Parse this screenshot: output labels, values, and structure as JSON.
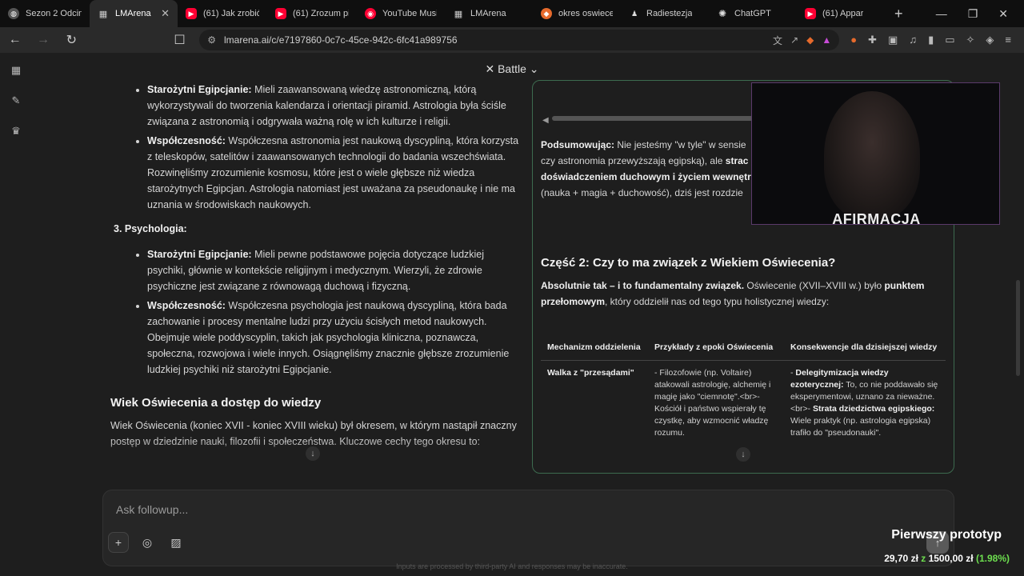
{
  "tabs": [
    {
      "label": "Sezon 2 Odcine",
      "icon": "globe-icon",
      "color": "#888888"
    },
    {
      "label": "LMArena",
      "icon": "table-icon",
      "color": "#bbbbbb",
      "active": true
    },
    {
      "label": "(61) Jak zrobić s",
      "icon": "youtube-icon",
      "color": "#ff0033"
    },
    {
      "label": "(61) Zrozum pi",
      "icon": "youtube-icon",
      "color": "#ff0033"
    },
    {
      "label": "YouTube Music",
      "icon": "youtube-music-icon",
      "color": "#ff0033"
    },
    {
      "label": "LMArena",
      "icon": "table-icon",
      "color": "#bbbbbb"
    },
    {
      "label": "okres oswiecen",
      "icon": "brave-icon",
      "color": "#e66a2c"
    },
    {
      "label": "Radiestezja",
      "icon": "pendulum-icon",
      "color": "#dddddd"
    },
    {
      "label": "ChatGPT",
      "icon": "openai-icon",
      "color": "#dddddd"
    },
    {
      "label": "(61) Appar",
      "icon": "youtube-icon",
      "color": "#ff0033"
    }
  ],
  "url": "lmarena.ai/c/e7197860-0c7c-45ce-942c-6fc41a989756",
  "header": {
    "mode": "Battle"
  },
  "left": {
    "egypt_astro_label": "Starożytni Egipcjanie:",
    "egypt_astro_text": " Mieli zaawansowaną wiedzę astronomiczną, którą wykorzystywali do tworzenia kalendarza i orientacji piramid. Astrologia była ściśle związana z astronomią i odgrywała ważną rolę w ich kulturze i religii.",
    "modern_astro_label": "Współczesność:",
    "modern_astro_text": " Współczesna astronomia jest naukową dyscypliną, która korzysta z teleskopów, satelitów i zaawansowanych technologii do badania wszechświata. Rozwinęliśmy zrozumienie kosmosu, które jest o wiele głębsze niż wiedza starożytnych Egipcjan. Astrologia natomiast jest uważana za pseudonaukę i nie ma uznania w środowiskach naukowych.",
    "section3": "3.  Psychologia:",
    "egypt_psy_label": "Starożytni Egipcjanie:",
    "egypt_psy_text": " Mieli pewne podstawowe pojęcia dotyczące ludzkiej psychiki, głównie w kontekście religijnym i medycznym. Wierzyli, że zdrowie psychiczne jest związane z równowagą duchową i fizyczną.",
    "modern_psy_label": "Współczesność:",
    "modern_psy_text": " Współczesna psychologia jest naukową dyscypliną, która bada zachowanie i procesy mentalne ludzi przy użyciu ścisłych metod naukowych. Obejmuje wiele poddyscyplin, takich jak psychologia kliniczna, poznawcza, społeczna, rozwojowa i wiele innych. Osiągnęliśmy znacznie głębsze zrozumienie ludzkiej psychiki niż starożytni Egipcjanie.",
    "heading": "Wiek Oświecenia a dostęp do wiedzy",
    "paragraph": "Wiek Oświecenia (koniec XVII - koniec XVIII wieku) był okresem, w którym nastąpił znaczny postęp w dziedzinie nauki, filozofii i społeczeństwa. Kluczowe cechy tego okresu to:"
  },
  "right": {
    "summary_label": "Podsumowując:",
    "summary_text1": " Nie jesteśmy \"w tyle\" w sensie",
    "summary_text2": "czy astronomia przewyższają egipską), ale",
    "summary_bold2": " strac",
    "summary_bold3": "doświadczeniem duchowym i życiem wewnętr",
    "summary_text4": "(nauka + magia + duchowość), dziś jest rozdzie",
    "heading": "Część 2: Czy to ma związek z Wiekiem Oświecenia?",
    "intro_bold": "Absolutnie tak – i to fundamentalny związek.",
    "intro_text": " Oświecenie (XVII–XVIII w.) było",
    "intro_bold2": " punktem przełomowym",
    "intro_text2": ", który oddzielił nas od tego typu holistycznej wiedzy:",
    "table": {
      "headers": [
        "Mechanizm oddzielenia",
        "Przykłady z epoki Oświecenia",
        "Konsekwencje dla dzisiejszej wiedzy"
      ],
      "row1": {
        "c1": "Walka z \"przesądami\"",
        "c2": "- Filozofowie (np. Voltaire) atakowali astrologię, alchemię i magię jako \"ciemnotę\".<br>- Kościół i państwo wspierały tę czystkę, aby wzmocnić władzę rozumu.",
        "c3_dash": "- ",
        "c3_bold1": "Delegitymizacja wiedzy ezoterycznej:",
        "c3_text1": " To, co nie poddawało się eksperymentowi, uznano za nieważne.<br>- ",
        "c3_bold2": "Strata dziedzictwa egipskiego:",
        "c3_text2": " Wiele praktyk (np. astrologia egipska) trafiło do \"pseudonauki\"."
      }
    }
  },
  "webcam": {
    "label": "AFIRMACJA"
  },
  "composer": {
    "placeholder": "Ask followup..."
  },
  "disclaimer": "Inputs are processed by third-party AI and responses may be inaccurate.",
  "overlay": {
    "title": "Pierwszy prototyp",
    "amount": "29,70 zł",
    "sep": " z ",
    "goal": "1500,00 zł",
    "percent": "(1.98%)"
  },
  "colors": {
    "accent_border": "#3d6b4f",
    "progress_green": "#6ddf4f"
  }
}
